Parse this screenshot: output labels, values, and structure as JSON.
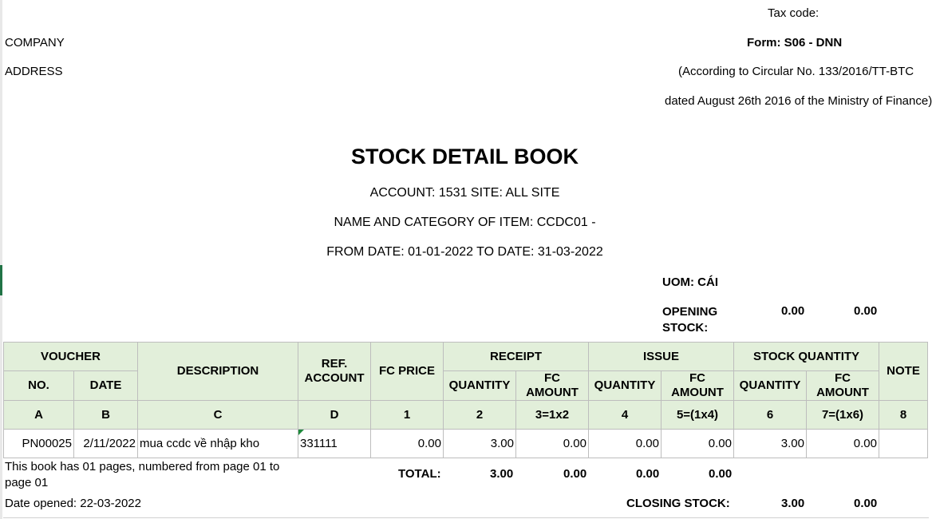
{
  "header": {
    "tax_code": "Tax code:",
    "company": "COMPANY",
    "address": "ADDRESS",
    "form": "Form: S06 - DNN",
    "circular": "(According to Circular No. 133/2016/TT-BTC",
    "dated": "dated August 26th 2016 of the Ministry of Finance)"
  },
  "title": "STOCK DETAIL BOOK",
  "account_line": "ACCOUNT: 1531 SITE:  ALL SITE",
  "item_line": "NAME AND CATEGORY OF ITEM: CCDC01 -",
  "date_line": "FROM DATE: 01-01-2022 TO DATE: 31-03-2022",
  "uom": "UOM: CÁI",
  "opening": {
    "label": "OPENING STOCK:",
    "quantity": "0.00",
    "amount": "0.00"
  },
  "table": {
    "voucher": "VOUCHER",
    "no": "NO.",
    "date": "DATE",
    "description": "DESCRIPTION",
    "ref_account": "REF. ACCOUNT",
    "fc_price": "FC PRICE",
    "receipt": "RECEIPT",
    "issue": "ISSUE",
    "stock_quantity": "STOCK QUANTITY",
    "note": "NOTE",
    "quantity": "QUANTITY",
    "fc_amount": "FC AMOUNT",
    "codes": [
      "A",
      "B",
      "C",
      "D",
      "1",
      "2",
      "3=1x2",
      "4",
      "5=(1x4)",
      "6",
      "7=(1x6)",
      "8"
    ],
    "rows": [
      {
        "no": "PN00025",
        "date": "2/11/2022",
        "description": "mua ccdc về nhập kho",
        "ref_account": "331111",
        "fc_price": "0.00",
        "receipt_qty": "3.00",
        "receipt_amt": "0.00",
        "issue_qty": "0.00",
        "issue_amt": "0.00",
        "stock_qty": "3.00",
        "stock_amt": "0.00",
        "note": ""
      }
    ]
  },
  "footer": {
    "pages_note": "This book has 01 pages, numbered from page 01 to page 01",
    "total_label": "TOTAL:",
    "total_receipt_qty": "3.00",
    "total_receipt_amt": "0.00",
    "total_issue_qty": "0.00",
    "total_issue_amt": "0.00",
    "date_opened": "Date opened:  22-03-2022",
    "closing_label": "CLOSING STOCK:",
    "closing_qty": "3.00",
    "closing_amt": "0.00"
  }
}
